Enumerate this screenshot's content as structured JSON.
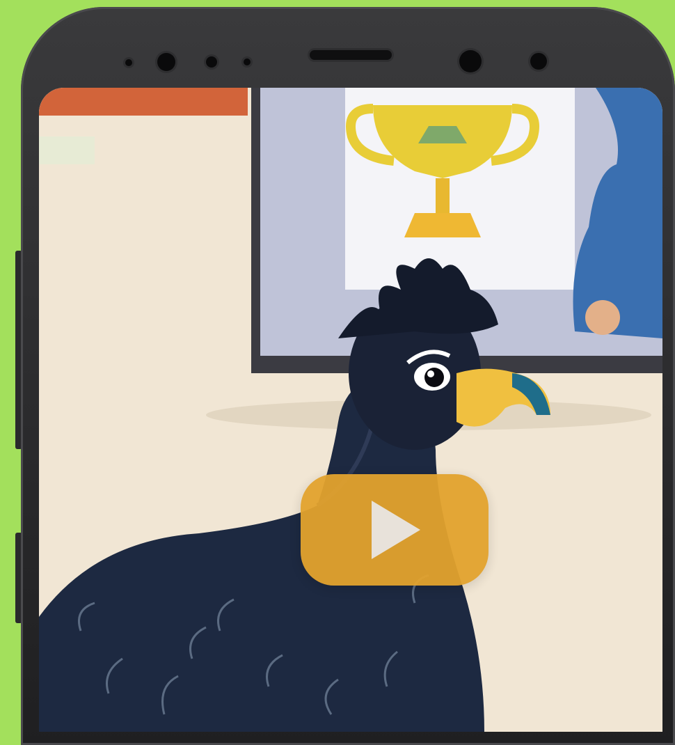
{
  "app": {
    "type": "video-preview"
  },
  "video": {
    "state": "paused",
    "play_icon": "play-icon"
  },
  "colors": {
    "background": "#a3e05c",
    "play_button": "#e3a32e",
    "phone_frame": "#2a2a2c"
  }
}
